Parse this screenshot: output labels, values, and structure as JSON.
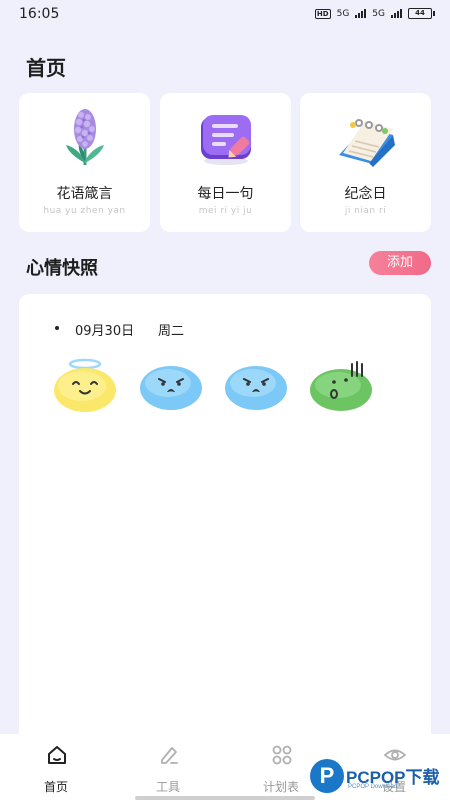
{
  "status_bar": {
    "time": "16:05",
    "network_1": "5G",
    "network_2": "5G",
    "battery": "44"
  },
  "header": {
    "title": "首页"
  },
  "tools": [
    {
      "title": "花语箴言",
      "pinyin": "hua yu zhen yan",
      "icon": "hyacinth-flower-icon"
    },
    {
      "title": "每日一句",
      "pinyin": "mei ri yi ju",
      "icon": "notebook-pen-icon"
    },
    {
      "title": "纪念日",
      "pinyin": "ji nian ri",
      "icon": "desk-calendar-icon"
    }
  ],
  "mood_section": {
    "title": "心情快照",
    "add_label": "添加",
    "entries": [
      {
        "date": "09月30日",
        "weekday": "周二",
        "moods": [
          "angel-smile",
          "surprised",
          "surprised",
          "speechless"
        ]
      }
    ]
  },
  "tab_bar": {
    "items": [
      {
        "label": "首页",
        "icon": "home-icon",
        "active": true
      },
      {
        "label": "工具",
        "icon": "edit-icon",
        "active": false
      },
      {
        "label": "计划表",
        "icon": "grid-icon",
        "active": false
      },
      {
        "label": "设置",
        "icon": "eye-icon",
        "active": false
      }
    ]
  },
  "watermark": {
    "brand": "PCPOP下载",
    "sub": "PCPOP Download"
  },
  "colors": {
    "background": "#eff0fb",
    "accent": "#f06a88",
    "card": "#ffffff"
  }
}
